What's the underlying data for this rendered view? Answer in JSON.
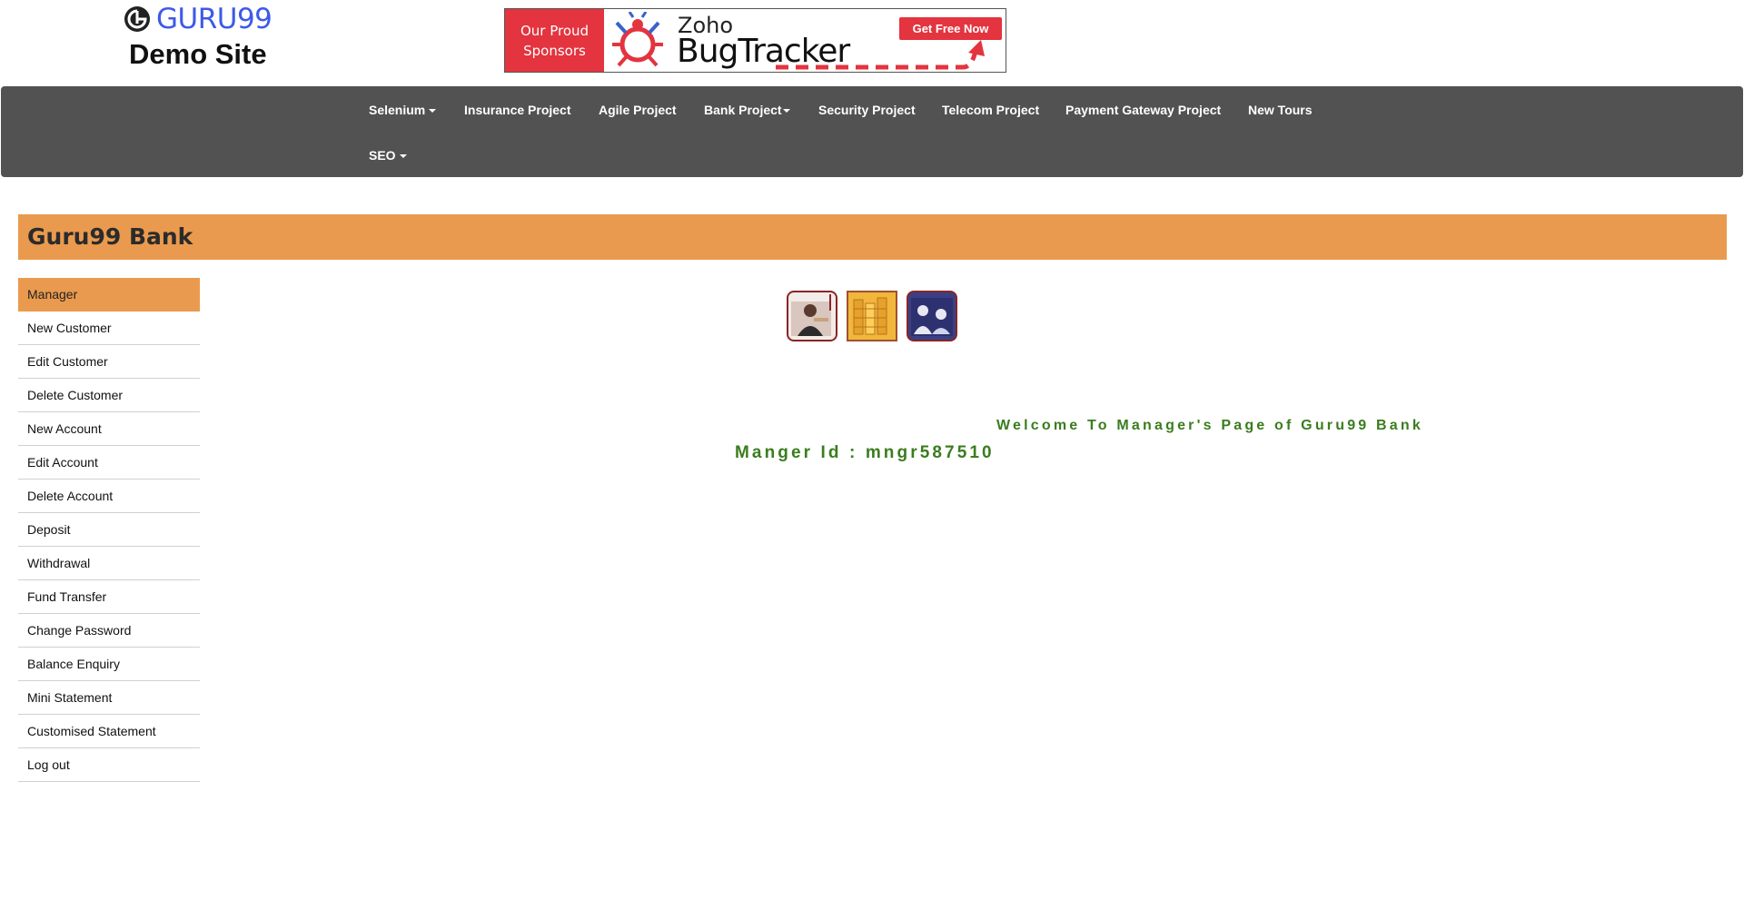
{
  "logo": {
    "brand": "GURU99",
    "subtitle": "Demo Site",
    "brand_color": "#3d5ae8"
  },
  "banner": {
    "tagline_line1": "Our Proud",
    "tagline_line2": "Sponsors",
    "brand": "Zoho",
    "product": "BugTracker",
    "cta": "Get Free Now",
    "accent": "#e3343f"
  },
  "nav": {
    "background": "#525252",
    "items": [
      {
        "label": "Selenium",
        "dropdown": true
      },
      {
        "label": "Insurance Project",
        "dropdown": false
      },
      {
        "label": "Agile Project",
        "dropdown": false
      },
      {
        "label": "Bank Project",
        "dropdown": true
      },
      {
        "label": "Security Project",
        "dropdown": false
      },
      {
        "label": "Telecom Project",
        "dropdown": false
      },
      {
        "label": "Payment Gateway Project",
        "dropdown": false
      },
      {
        "label": "New Tours",
        "dropdown": false
      },
      {
        "label": "SEO",
        "dropdown": true
      }
    ]
  },
  "bank": {
    "title": "Guru99 Bank",
    "accent": "#ea9a4e"
  },
  "sidebar": {
    "items": [
      {
        "label": "Manager",
        "active": true
      },
      {
        "label": "New Customer"
      },
      {
        "label": "Edit Customer"
      },
      {
        "label": "Delete Customer"
      },
      {
        "label": "New Account"
      },
      {
        "label": "Edit Account"
      },
      {
        "label": "Delete Account"
      },
      {
        "label": "Deposit"
      },
      {
        "label": "Withdrawal"
      },
      {
        "label": "Fund Transfer"
      },
      {
        "label": "Change Password"
      },
      {
        "label": "Balance Enquiry"
      },
      {
        "label": "Mini Statement"
      },
      {
        "label": "Customised Statement"
      },
      {
        "label": "Log out"
      }
    ]
  },
  "main": {
    "images": [
      "manager-photo-icon",
      "coins-stack-icon",
      "people-meeting-icon"
    ],
    "welcome": "Welcome To Manager's Page of Guru99 Bank",
    "manager_id": "Manger Id : mngr587510",
    "text_color": "#3a7d1e"
  }
}
